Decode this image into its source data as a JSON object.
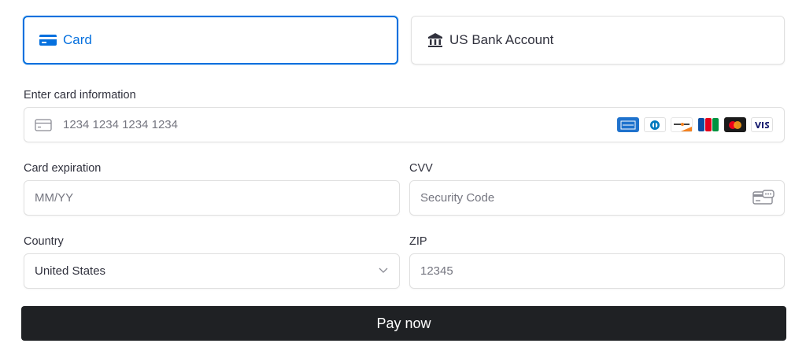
{
  "tabs": [
    {
      "label": "Card",
      "icon": "credit-card-icon",
      "selected": true
    },
    {
      "label": "US Bank Account",
      "icon": "bank-icon",
      "selected": false
    }
  ],
  "card": {
    "label": "Enter card information",
    "placeholder": "1234 1234 1234 1234",
    "brands": [
      "American Express",
      "Diners Club",
      "Discover",
      "JCB",
      "Mastercard",
      "Visa"
    ]
  },
  "expiration": {
    "label": "Card expiration",
    "placeholder": "MM/YY"
  },
  "cvv": {
    "label": "CVV",
    "placeholder": "Security Code"
  },
  "country": {
    "label": "Country",
    "value": "United States"
  },
  "zip": {
    "label": "ZIP",
    "placeholder": "12345"
  },
  "pay_button": {
    "label": "Pay now"
  },
  "colors": {
    "accent": "#0570de",
    "button": "#1f2124"
  }
}
